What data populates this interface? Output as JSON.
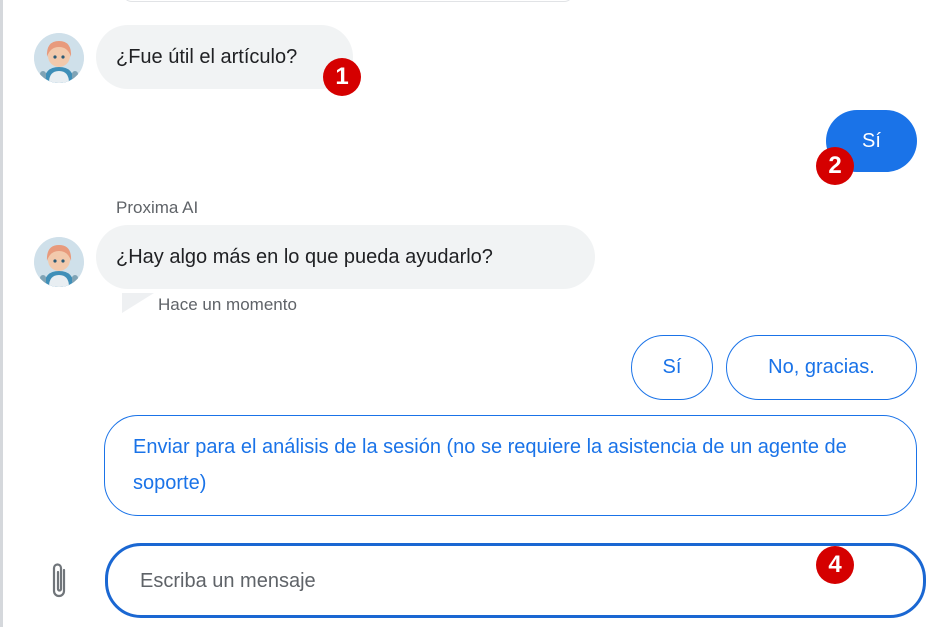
{
  "conversation": {
    "messages": [
      {
        "role": "bot",
        "text": "¿Fue útil el artículo?"
      },
      {
        "role": "user",
        "text": "Sí"
      },
      {
        "role": "bot",
        "sender": "Proxima AI",
        "text": "¿Hay algo más en lo que pueda ayudarlo?",
        "timestamp": "Hace un momento"
      }
    ],
    "quick_replies": [
      "Sí",
      "No, gracias.",
      "Enviar para el análisis de la sesión (no se requiere la asistencia de un agente de soporte)"
    ]
  },
  "composer": {
    "placeholder": "Escriba un mensaje",
    "attach_icon": "paperclip-icon"
  },
  "annotations": [
    "1",
    "2",
    "4"
  ],
  "colors": {
    "accent": "#1a73e8",
    "bot_bubble": "#f1f3f4",
    "marker": "#d50000"
  }
}
